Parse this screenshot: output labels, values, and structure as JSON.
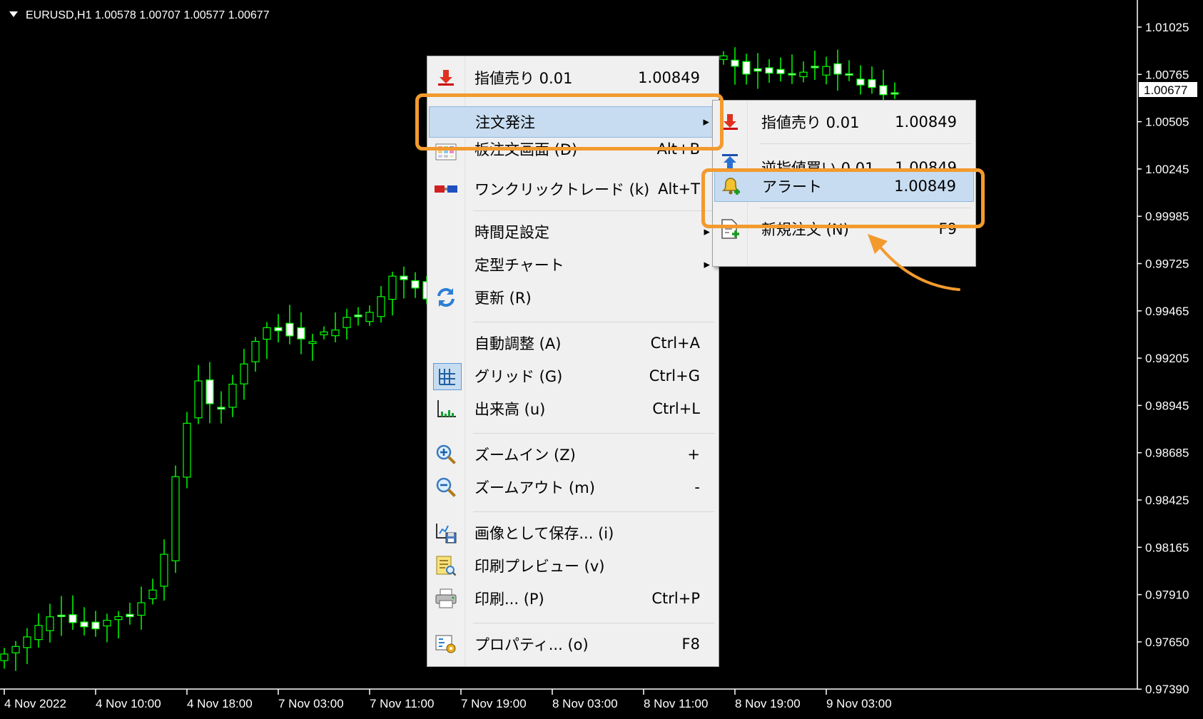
{
  "chart": {
    "symbol_info": "EURUSD,H1  1.00578 1.00707 1.00577 1.00677",
    "price_labels": [
      "1.01025",
      "1.00765",
      "1.00505",
      "1.00245",
      "0.99985",
      "0.99725",
      "0.99465",
      "0.99205",
      "0.98945",
      "0.98685",
      "0.98425",
      "0.98165",
      "0.97910",
      "0.97650",
      "0.97390"
    ],
    "current_price": "1.00677",
    "time_labels": [
      "4 Nov 2022",
      "4 Nov 10:00",
      "4 Nov 18:00",
      "7 Nov 03:00",
      "7 Nov 11:00",
      "7 Nov 19:00",
      "8 Nov 03:00",
      "8 Nov 11:00",
      "8 Nov 19:00",
      "9 Nov 03:00"
    ],
    "colors": {
      "background": "#000000",
      "candle": "#00ff00",
      "bull_body": "#000000",
      "bear_body": "#ffffff",
      "axis": "#ffffff"
    }
  },
  "context_menu": {
    "items": [
      {
        "icon": "arrow-down-icon",
        "label": "指値売り 0.01",
        "shortcut": "1.00849"
      },
      {
        "icon": "",
        "label": "注文発注",
        "shortcut": "",
        "submenu": true
      },
      {
        "icon": "board-order-icon",
        "label": "板注文画面 (D)",
        "shortcut": "Alt+B"
      },
      {
        "icon": "one-click-trade-icon",
        "label": "ワンクリックトレード (k)",
        "shortcut": "Alt+T"
      },
      {
        "icon": "",
        "label": "時間足設定",
        "shortcut": "",
        "submenu": true
      },
      {
        "icon": "",
        "label": "定型チャート",
        "shortcut": "",
        "submenu": true
      },
      {
        "icon": "refresh-icon",
        "label": "更新 (R)",
        "shortcut": ""
      },
      {
        "icon": "",
        "label": "自動調整 (A)",
        "shortcut": "Ctrl+A"
      },
      {
        "icon": "grid-icon",
        "label": "グリッド (G)",
        "shortcut": "Ctrl+G"
      },
      {
        "icon": "volume-icon",
        "label": "出来高 (u)",
        "shortcut": "Ctrl+L"
      },
      {
        "icon": "zoom-in-icon",
        "label": "ズームイン (Z)",
        "shortcut": "+"
      },
      {
        "icon": "zoom-out-icon",
        "label": "ズームアウト (m)",
        "shortcut": "-"
      },
      {
        "icon": "save-image-icon",
        "label": "画像として保存... (i)",
        "shortcut": ""
      },
      {
        "icon": "print-preview-icon",
        "label": "印刷プレビュー (v)",
        "shortcut": ""
      },
      {
        "icon": "print-icon",
        "label": "印刷... (P)",
        "shortcut": "Ctrl+P"
      },
      {
        "icon": "properties-icon",
        "label": "プロパティ... (o)",
        "shortcut": "F8"
      }
    ]
  },
  "submenu": {
    "items": [
      {
        "icon": "arrow-down-icon",
        "label": "指値売り 0.01",
        "shortcut": "1.00849"
      },
      {
        "icon": "arrow-up-icon",
        "label": "逆指値買い 0.01",
        "shortcut": "1.00849"
      },
      {
        "icon": "alert-bell-icon",
        "label": "アラート",
        "shortcut": "1.00849"
      },
      {
        "icon": "new-order-icon",
        "label": "新規注文 (N)",
        "shortcut": "F9"
      }
    ]
  }
}
